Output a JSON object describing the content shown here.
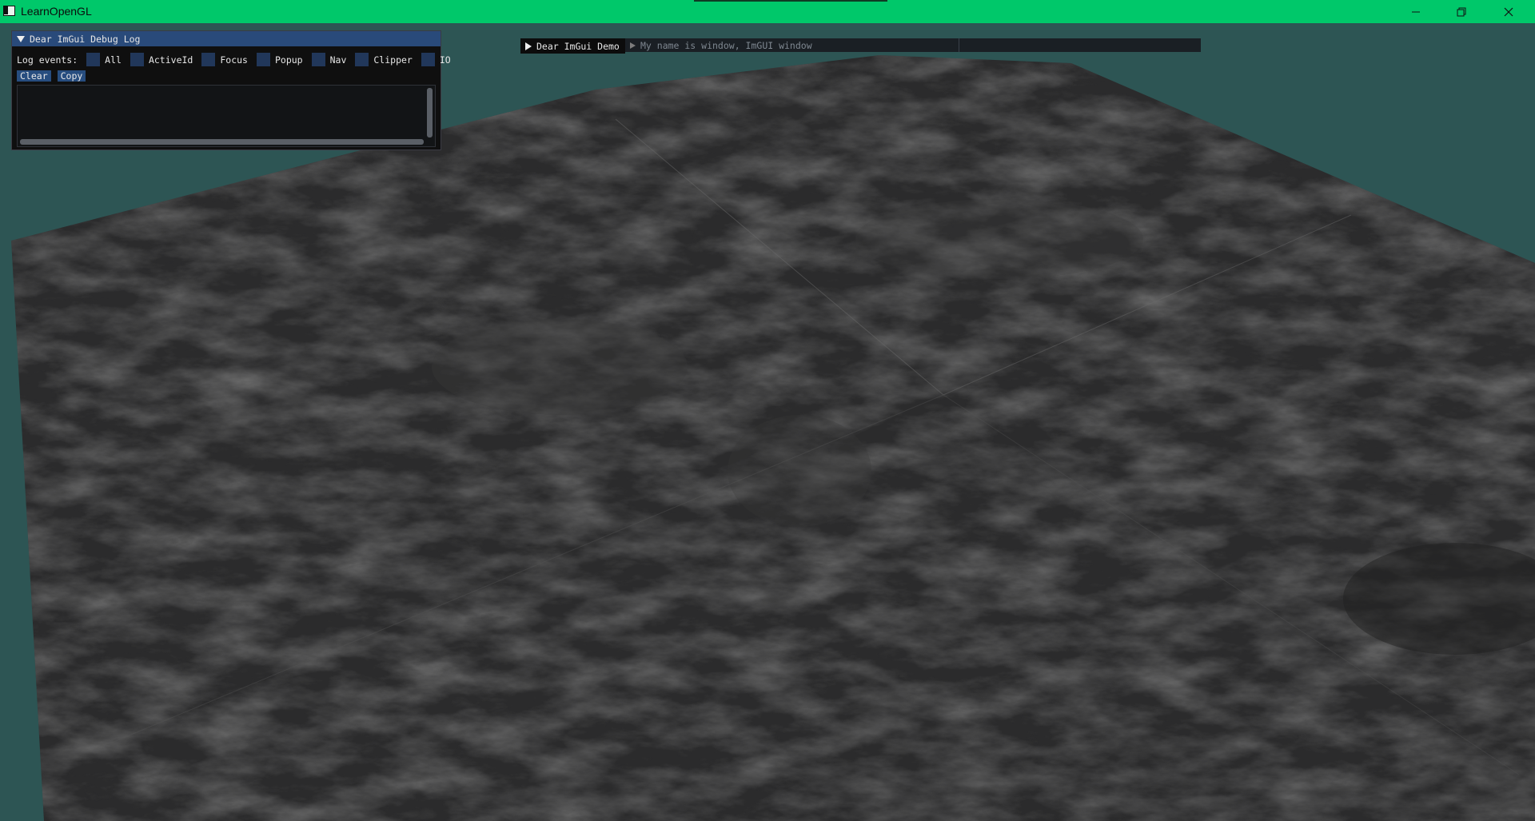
{
  "window": {
    "title": "LearnOpenGL",
    "icon": "app-window-icon",
    "controls": [
      "minimize-icon",
      "maximize-icon",
      "close-icon"
    ],
    "accent_color": "#00c86a"
  },
  "scene": {
    "background_color": "#2d5554",
    "terrain_color": "#2b2b2b"
  },
  "debug_log": {
    "title": "Dear ImGui Debug Log",
    "log_events_label": "Log events:",
    "checkboxes": [
      {
        "label": "All",
        "checked": false
      },
      {
        "label": "ActiveId",
        "checked": false
      },
      {
        "label": "Focus",
        "checked": false
      },
      {
        "label": "Popup",
        "checked": false
      },
      {
        "label": "Nav",
        "checked": false
      },
      {
        "label": "Clipper",
        "checked": false
      },
      {
        "label": "IO",
        "checked": false
      }
    ],
    "buttons": {
      "clear": "Clear",
      "copy": "Copy"
    }
  },
  "demo_window": {
    "title": "Dear ImGui Demo"
  },
  "name_window": {
    "title": "My name is window, ImGUI window"
  }
}
